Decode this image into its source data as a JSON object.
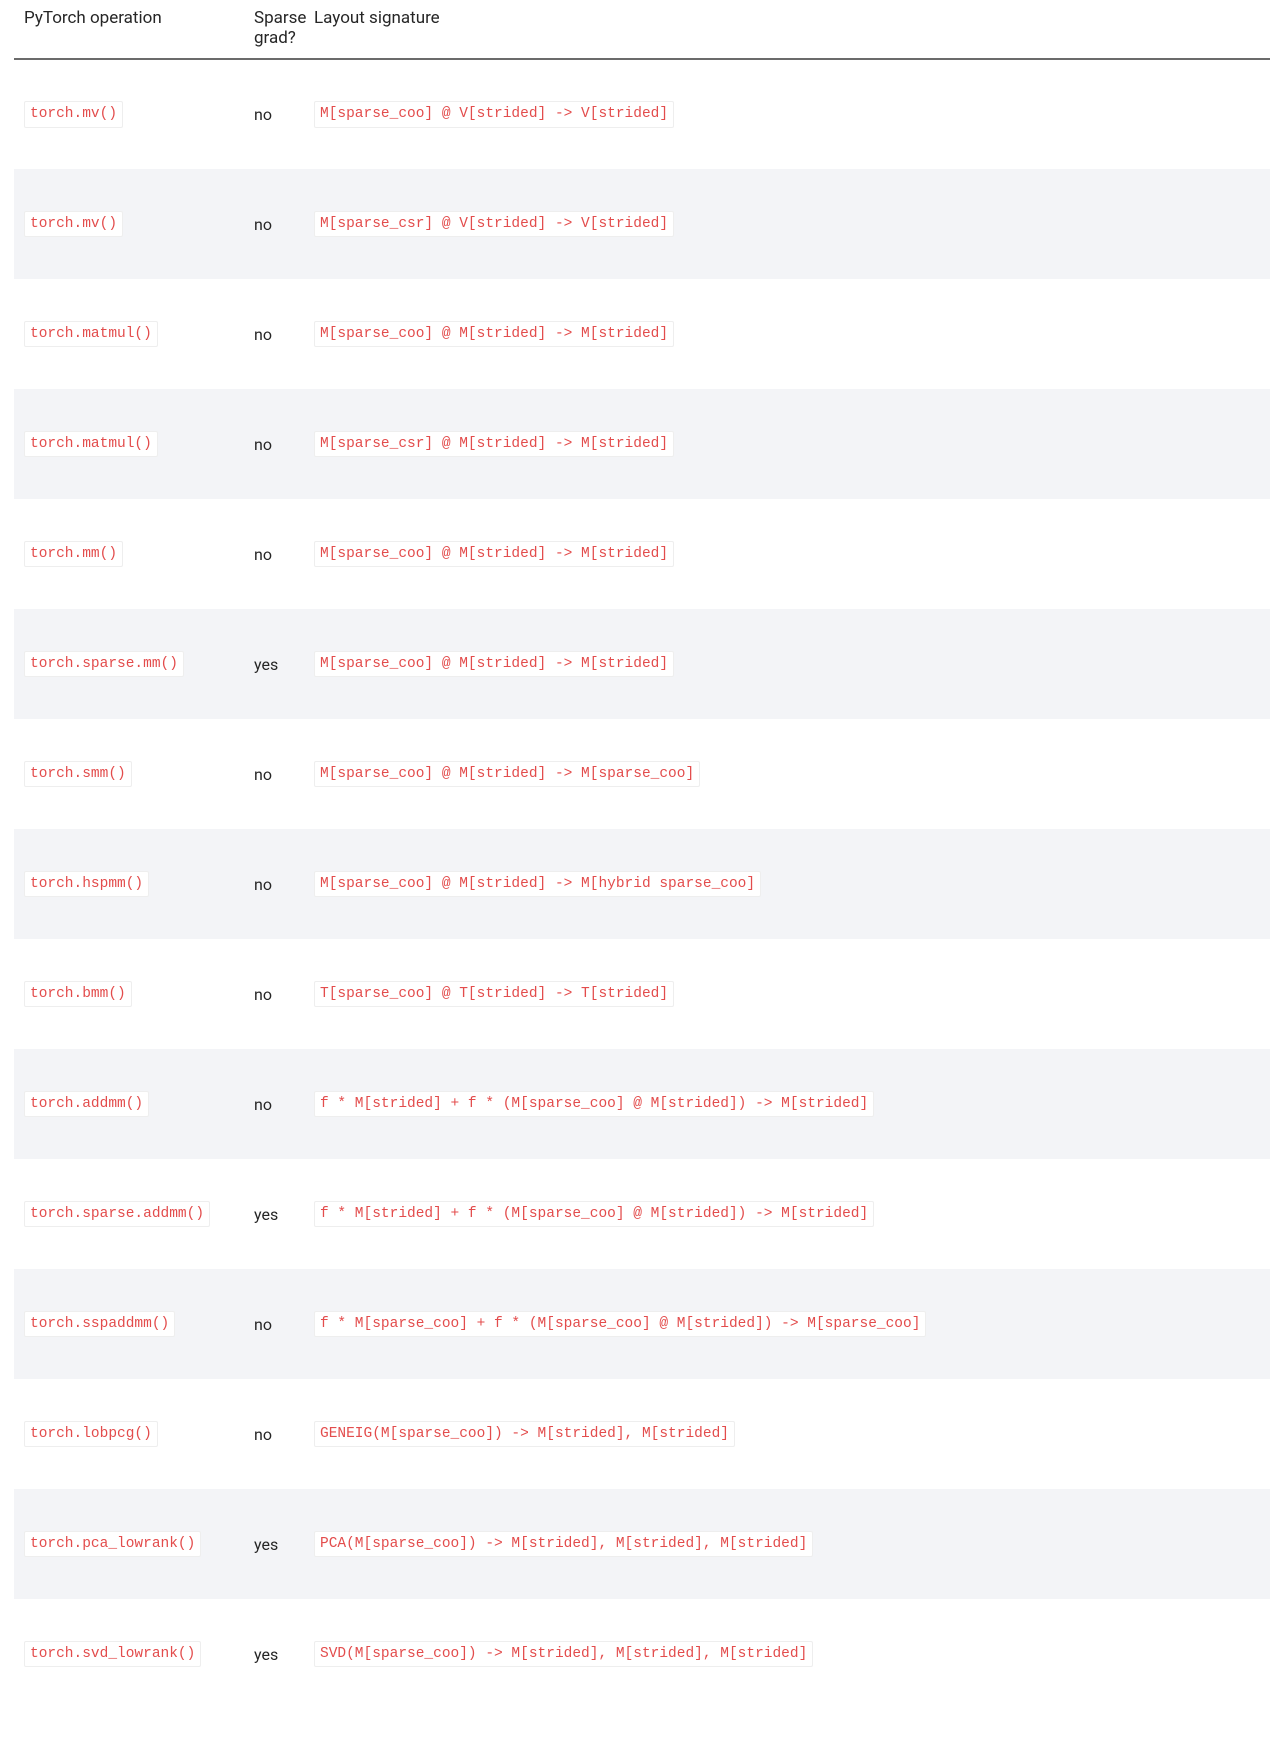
{
  "table": {
    "headers": {
      "operation": "PyTorch operation",
      "sparse_grad": "Sparse grad?",
      "layout": "Layout signature"
    },
    "rows": [
      {
        "op": "torch.mv()",
        "grad": "no",
        "sig": "M[sparse_coo] @ V[strided] -> V[strided]"
      },
      {
        "op": "torch.mv()",
        "grad": "no",
        "sig": "M[sparse_csr] @ V[strided] -> V[strided]"
      },
      {
        "op": "torch.matmul()",
        "grad": "no",
        "sig": "M[sparse_coo] @ M[strided] -> M[strided]"
      },
      {
        "op": "torch.matmul()",
        "grad": "no",
        "sig": "M[sparse_csr] @ M[strided] -> M[strided]"
      },
      {
        "op": "torch.mm()",
        "grad": "no",
        "sig": "M[sparse_coo] @ M[strided] -> M[strided]"
      },
      {
        "op": "torch.sparse.mm()",
        "grad": "yes",
        "sig": "M[sparse_coo] @ M[strided] -> M[strided]"
      },
      {
        "op": "torch.smm()",
        "grad": "no",
        "sig": "M[sparse_coo] @ M[strided] -> M[sparse_coo]"
      },
      {
        "op": "torch.hspmm()",
        "grad": "no",
        "sig": "M[sparse_coo] @ M[strided] -> M[hybrid sparse_coo]"
      },
      {
        "op": "torch.bmm()",
        "grad": "no",
        "sig": "T[sparse_coo] @ T[strided] -> T[strided]"
      },
      {
        "op": "torch.addmm()",
        "grad": "no",
        "sig": "f * M[strided] + f * (M[sparse_coo] @ M[strided]) -> M[strided]"
      },
      {
        "op": "torch.sparse.addmm()",
        "grad": "yes",
        "sig": "f * M[strided] + f * (M[sparse_coo] @ M[strided]) -> M[strided]"
      },
      {
        "op": "torch.sspaddmm()",
        "grad": "no",
        "sig": "f * M[sparse_coo] + f * (M[sparse_coo] @ M[strided]) -> M[sparse_coo]"
      },
      {
        "op": "torch.lobpcg()",
        "grad": "no",
        "sig": "GENEIG(M[sparse_coo]) -> M[strided], M[strided]"
      },
      {
        "op": "torch.pca_lowrank()",
        "grad": "yes",
        "sig": "PCA(M[sparse_coo]) -> M[strided], M[strided], M[strided]"
      },
      {
        "op": "torch.svd_lowrank()",
        "grad": "yes",
        "sig": "SVD(M[sparse_coo]) -> M[strided], M[strided], M[strided]"
      }
    ]
  }
}
